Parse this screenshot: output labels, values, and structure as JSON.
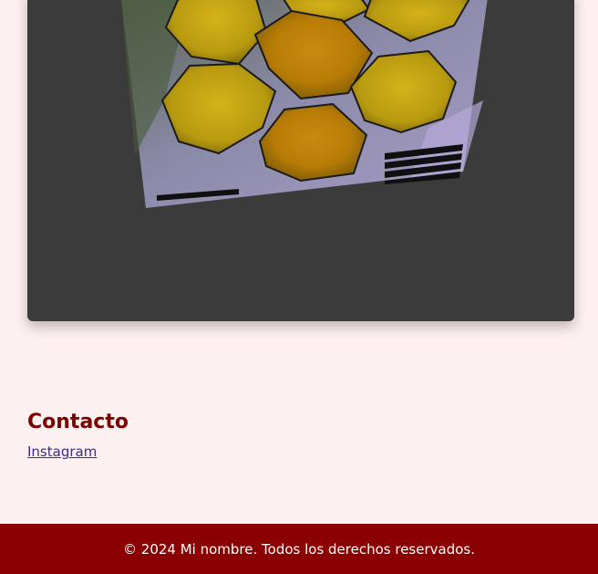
{
  "contact": {
    "title": "Contacto",
    "links": [
      {
        "label": "Instagram"
      }
    ]
  },
  "footer": {
    "text": "© 2024 Mi nombre. Todos los derechos reservados."
  },
  "colors": {
    "background": "#fdf0f0",
    "card": "#3b3b3b",
    "accent": "#7a0000",
    "footer": "#8b0000",
    "link": "#3a2c8a"
  }
}
